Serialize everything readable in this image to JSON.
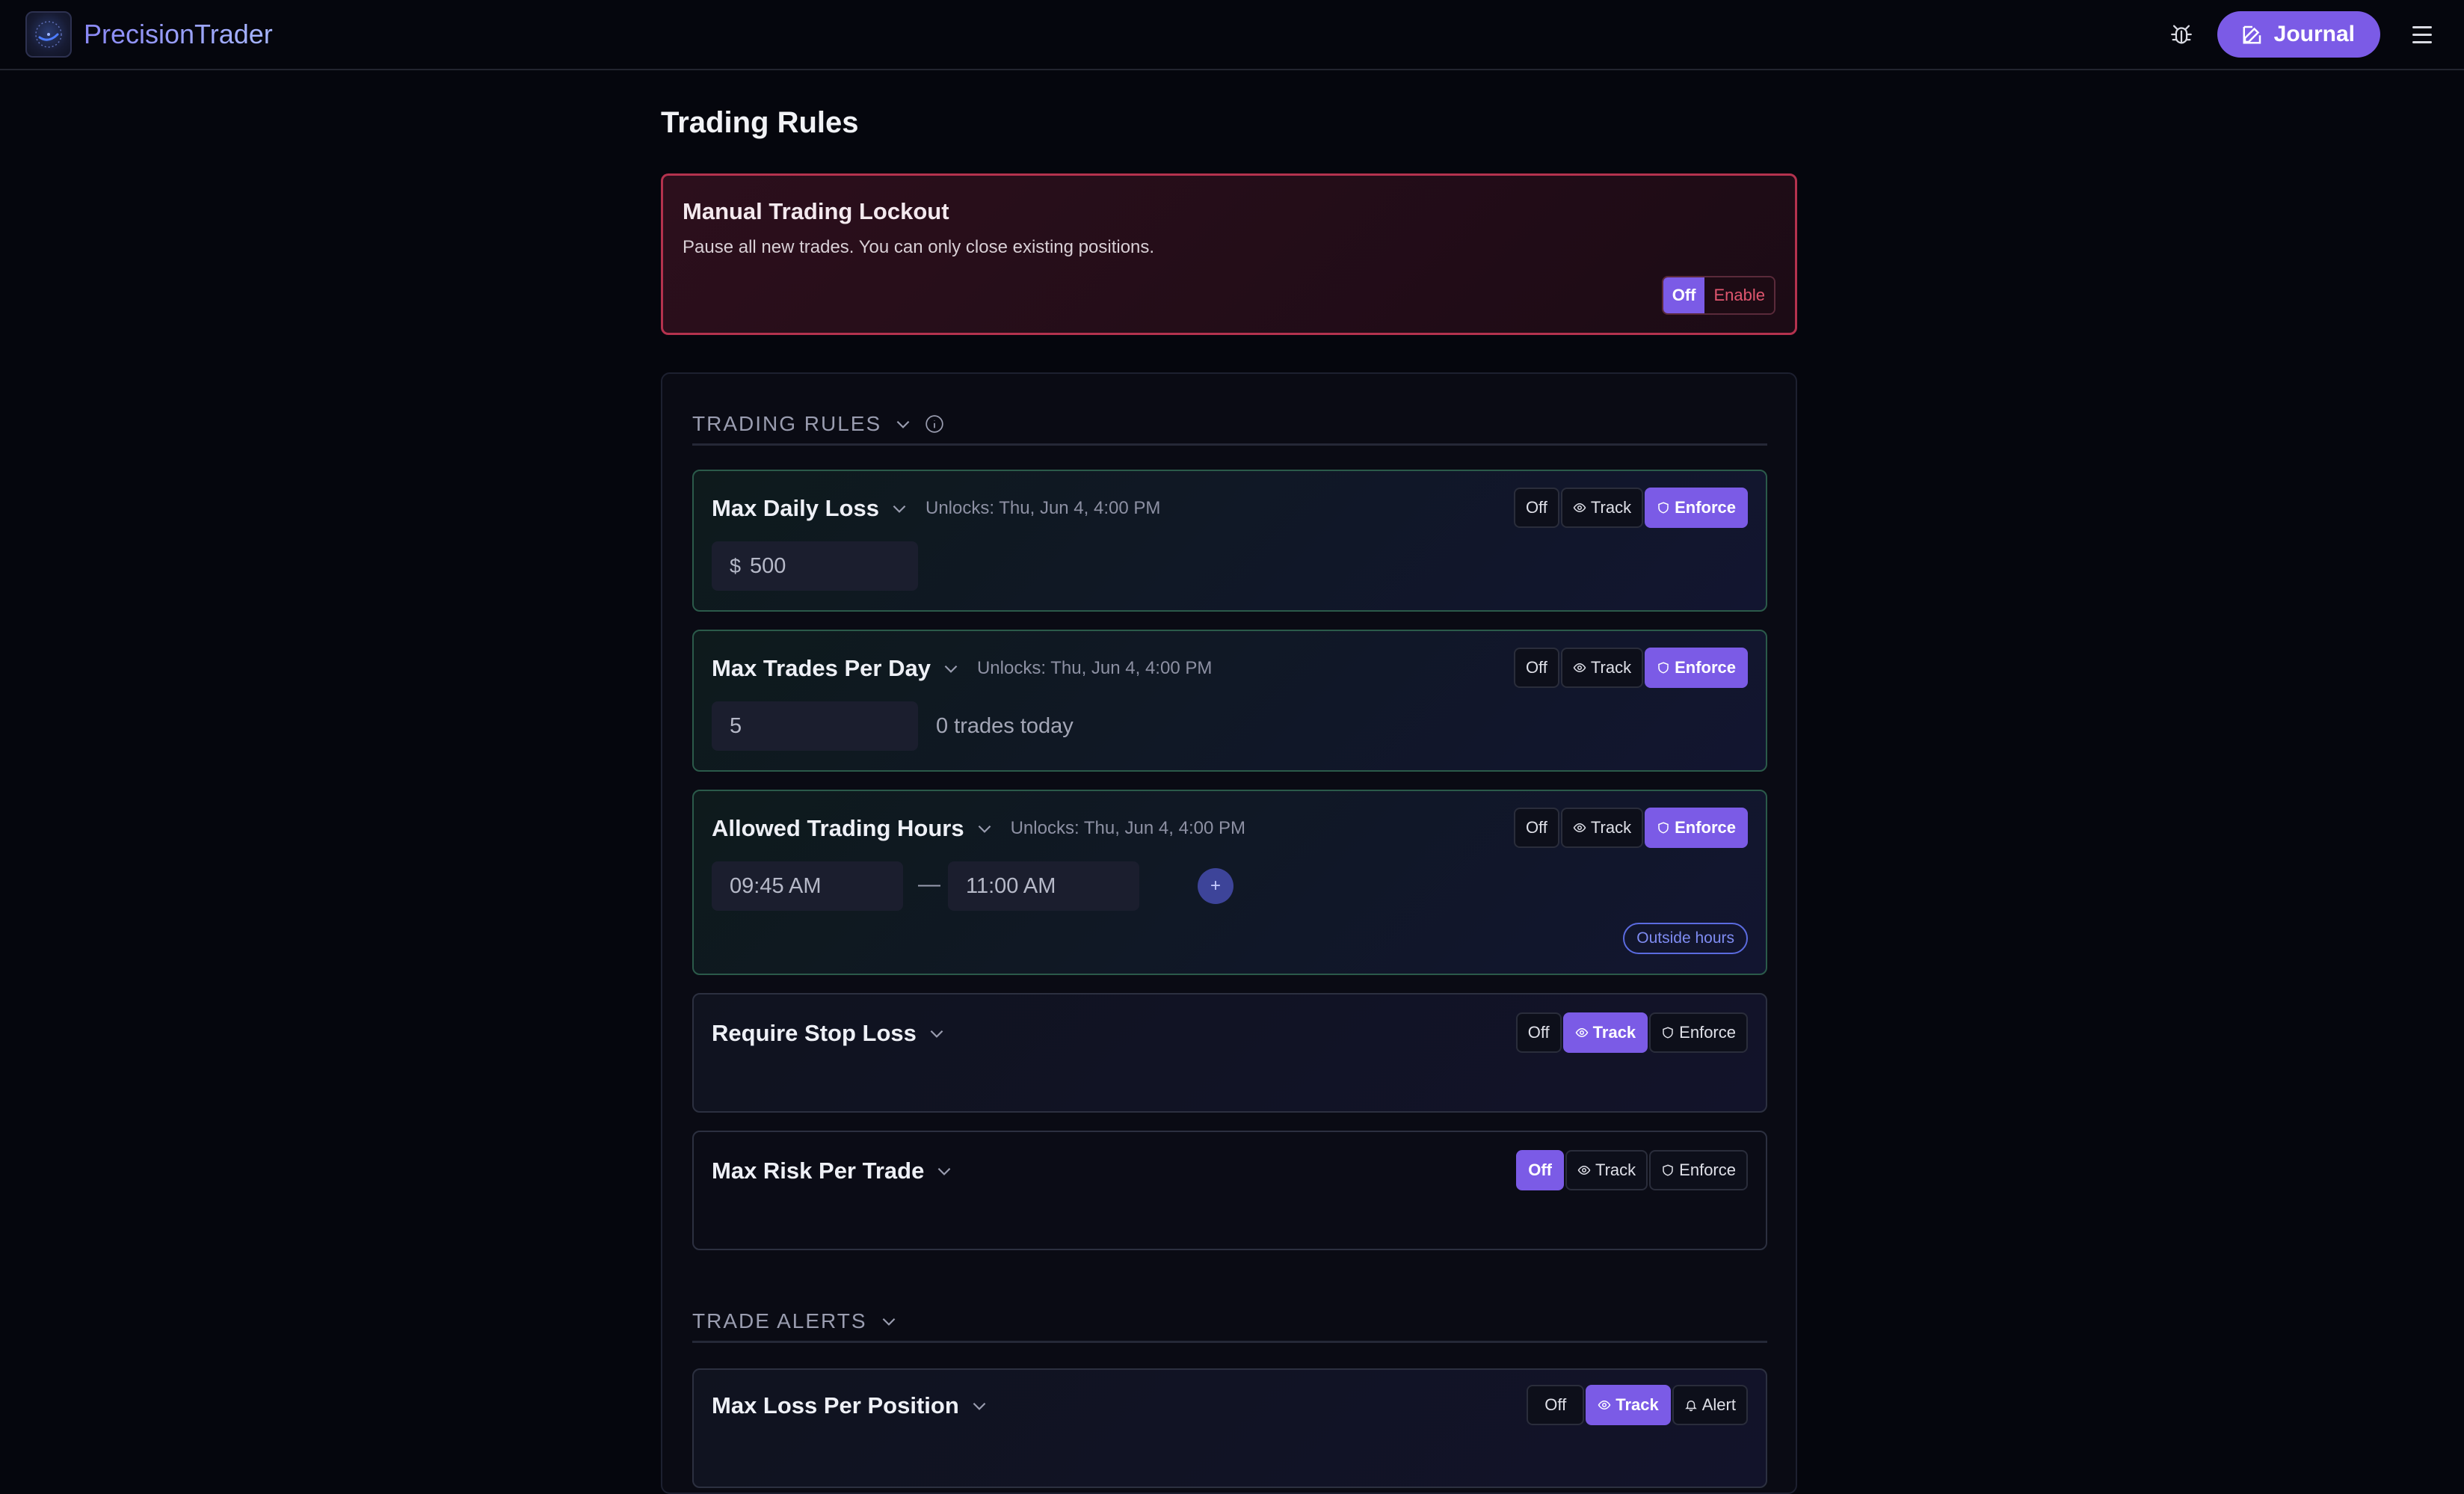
{
  "app": {
    "name": "PrecisionTrader"
  },
  "header": {
    "journal_label": "Journal"
  },
  "page": {
    "title": "Trading Rules"
  },
  "lockout": {
    "title": "Manual Trading Lockout",
    "description": "Pause all new trades. You can only close existing positions.",
    "off_label": "Off",
    "enable_label": "Enable"
  },
  "sections": {
    "trading_rules": "TRADING RULES",
    "trade_alerts": "TRADE ALERTS"
  },
  "modes": {
    "off": "Off",
    "track": "Track",
    "enforce": "Enforce",
    "alert": "Alert"
  },
  "rules": [
    {
      "title": "Max Daily Loss",
      "unlocks": "Unlocks: Thu, Jun 4, 4:00 PM",
      "mode": "Enforce",
      "prefix": "$",
      "value": "500"
    },
    {
      "title": "Max Trades Per Day",
      "unlocks": "Unlocks: Thu, Jun 4, 4:00 PM",
      "mode": "Enforce",
      "value": "5",
      "note": "0 trades today"
    },
    {
      "title": "Allowed Trading Hours",
      "unlocks": "Unlocks: Thu, Jun 4, 4:00 PM",
      "mode": "Enforce",
      "start": "09:45 AM",
      "separator": "—",
      "end": "11:00 AM",
      "add_label": "+",
      "status": "Outside hours"
    },
    {
      "title": "Require Stop Loss",
      "mode": "Track"
    },
    {
      "title": "Max Risk Per Trade",
      "mode": "Off"
    }
  ],
  "alerts": [
    {
      "title": "Max Loss Per Position",
      "mode": "Track"
    }
  ],
  "colors": {
    "accent": "#7b5be6",
    "danger": "#b4324e",
    "background": "#05060d"
  }
}
